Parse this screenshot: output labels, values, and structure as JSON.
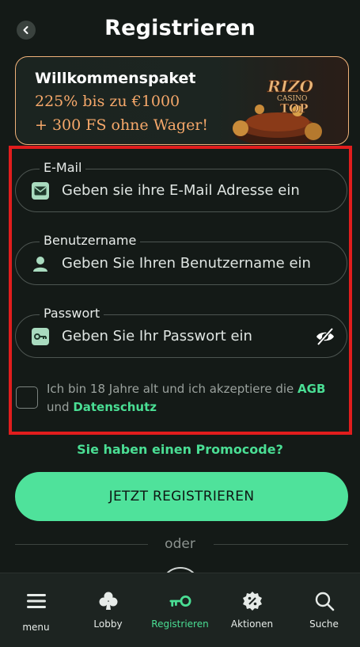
{
  "header": {
    "title": "Registrieren",
    "back_icon": "chevron-left-icon"
  },
  "promo": {
    "title": "Willkommenspaket",
    "line1": "225% bis zu €1000",
    "line2": "+ 300 FS ohne Wager!",
    "logo_text_1": "RIZO",
    "logo_text_2": "CASINO",
    "logo_text_3": "TOP",
    "accent_color": "#f6a86a"
  },
  "form": {
    "email": {
      "label": "E-Mail",
      "placeholder": "Geben sie ihre E-Mail Adresse ein",
      "value": "",
      "icon": "envelope-icon"
    },
    "username": {
      "label": "Benutzername",
      "placeholder": "Geben Sie Ihren Benutzername ein",
      "value": "",
      "icon": "user-icon"
    },
    "password": {
      "label": "Passwort",
      "placeholder": "Geben Sie Ihr Passwort ein",
      "value": "",
      "icon": "key-icon",
      "toggle_icon": "eye-off-icon"
    },
    "terms": {
      "checked": false,
      "text_before": "Ich bin 18 Jahre alt und ich akzeptiere die ",
      "agb_link": "AGB",
      "text_middle": " und ",
      "privacy_link": "Datenschutz"
    },
    "highlight_color": "#e11d1d"
  },
  "promo_code_link": "Sie haben einen Promocode?",
  "submit_label": "JETZT REGISTRIEREN",
  "divider_text": "oder",
  "nav": {
    "items": [
      {
        "label": "menu",
        "icon": "hamburger-menu-icon",
        "active": false
      },
      {
        "label": "Lobby",
        "icon": "club-suit-icon",
        "active": false
      },
      {
        "label": "Registrieren",
        "icon": "key-icon",
        "active": true
      },
      {
        "label": "Aktionen",
        "icon": "percent-badge-icon",
        "active": false
      },
      {
        "label": "Suche",
        "icon": "search-icon",
        "active": false
      }
    ]
  },
  "colors": {
    "background": "#141a17",
    "accent_green": "#4ade94",
    "button_green": "#4fe29b"
  }
}
